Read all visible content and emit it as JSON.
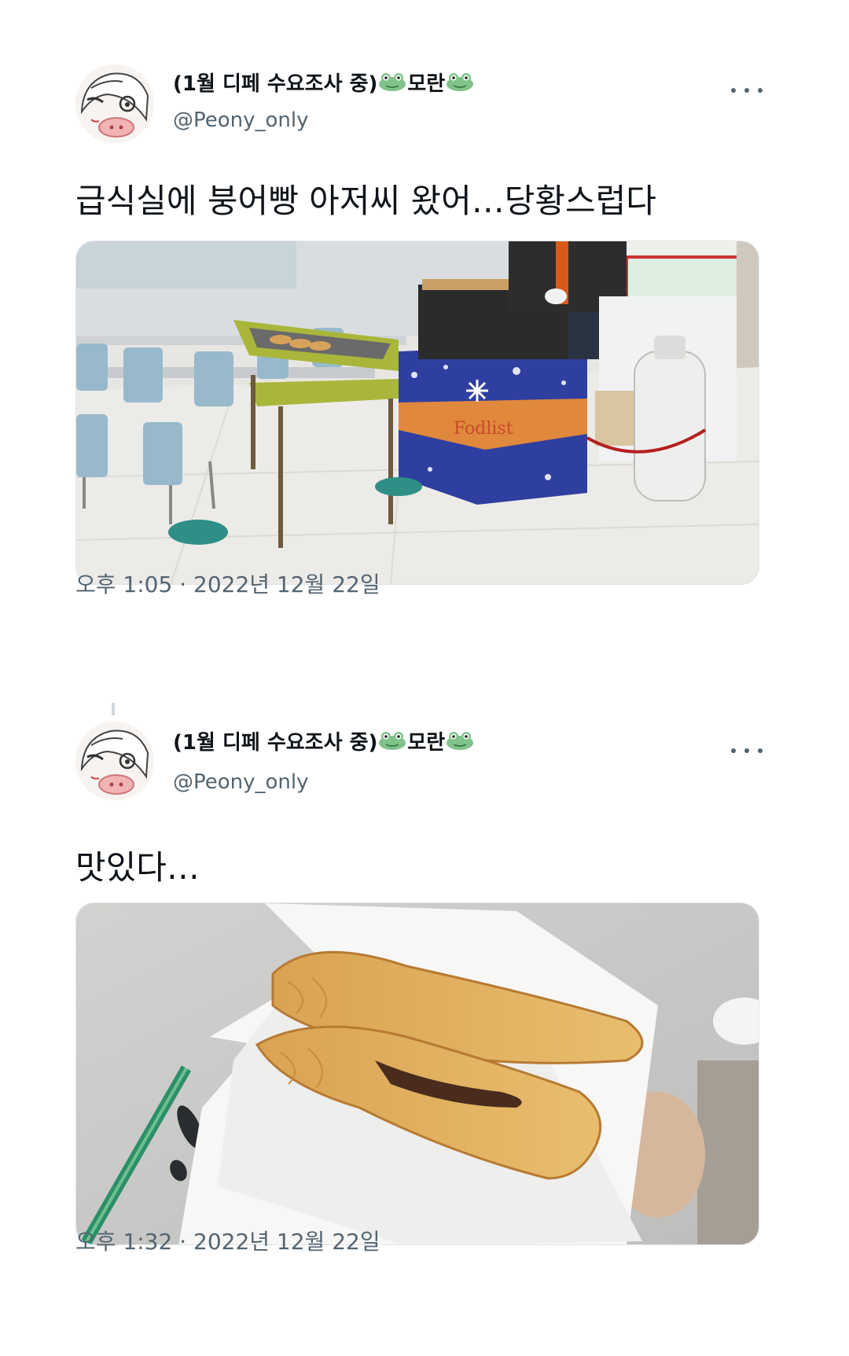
{
  "tweets": [
    {
      "display_name": "(1월 디페 수요조사 중)",
      "name_suffix": "모란",
      "handle": "@Peony_only",
      "text": "급식실에 붕어빵 아저씨 왔어…당황스럽다",
      "image_icon": "cafeteria-bungeoppang-stand-photo",
      "banner_text": "Fodlist",
      "time": "오후 1:05 · 2022년 12월 22일"
    },
    {
      "display_name": "(1월 디페 수요조사 중)",
      "name_suffix": "모란",
      "handle": "@Peony_only",
      "text": "맛있다…",
      "image_icon": "bungeoppang-in-napkin-photo",
      "time": "오후 1:32 · 2022년 12월 22일"
    }
  ],
  "colors": {
    "text": "#0f1419",
    "secondary": "#536471",
    "frog": "#7fc38a",
    "banner_blue": "#2f3fa0",
    "banner_orange": "#e0883c"
  }
}
